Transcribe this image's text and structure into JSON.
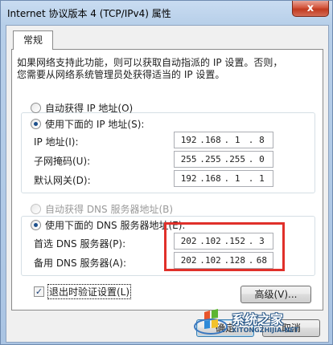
{
  "window": {
    "title": "Internet 协议版本 4 (TCP/IPv4) 属性",
    "close_glyph": "x"
  },
  "tabs": [
    {
      "label": "常规"
    }
  ],
  "description": {
    "line1": "如果网络支持此功能，则可以获取自动指派的 IP 设置。否则，",
    "line2": "您需要从网络系统管理员处获得适当的 IP 设置。"
  },
  "ip_section": {
    "auto_label": "自动获得 IP 地址(O)",
    "manual_label": "使用下面的 IP 地址(S):",
    "selected": "manual",
    "fields": [
      {
        "label": "IP 地址(I):",
        "octets": [
          "192",
          "168",
          "1",
          "8"
        ]
      },
      {
        "label": "子网掩码(U):",
        "octets": [
          "255",
          "255",
          "255",
          "0"
        ]
      },
      {
        "label": "默认网关(D):",
        "octets": [
          "192",
          "168",
          "1",
          "1"
        ]
      }
    ]
  },
  "dns_section": {
    "auto_label": "自动获得 DNS 服务器地址(B)",
    "manual_label": "使用下面的 DNS 服务器地址(E):",
    "selected": "manual",
    "fields": [
      {
        "label": "首选 DNS 服务器(P):",
        "octets": [
          "202",
          "102",
          "152",
          "3"
        ]
      },
      {
        "label": "备用 DNS 服务器(A):",
        "octets": [
          "202",
          "102",
          "128",
          "68"
        ]
      }
    ]
  },
  "validate_on_exit": {
    "label": "退出时验证设置(L)",
    "checked": true,
    "check_glyph": "✓"
  },
  "buttons": {
    "advanced": "高级(V)...",
    "ok": "确定",
    "cancel": "取消"
  },
  "watermark": {
    "title": "系统之家",
    "url": "XITONGZHIJIA.NET"
  },
  "colors": {
    "highlight": "#e0302a",
    "radio_dot": "#1c4f8b",
    "titlebar": "#b7cfe9",
    "close": "#c13a1f"
  }
}
